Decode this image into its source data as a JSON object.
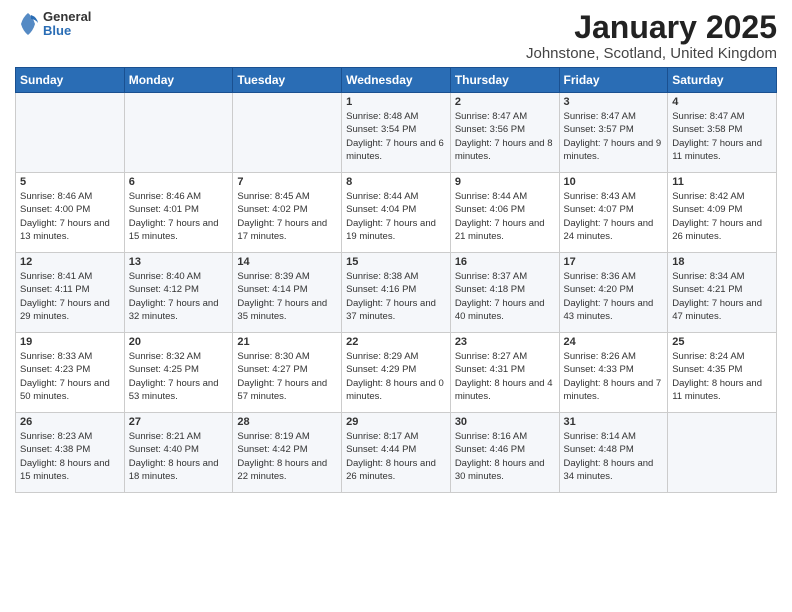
{
  "header": {
    "logo_general": "General",
    "logo_blue": "Blue",
    "main_title": "January 2025",
    "subtitle": "Johnstone, Scotland, United Kingdom"
  },
  "weekdays": [
    "Sunday",
    "Monday",
    "Tuesday",
    "Wednesday",
    "Thursday",
    "Friday",
    "Saturday"
  ],
  "weeks": [
    [
      {
        "day": "",
        "sunrise": "",
        "sunset": "",
        "daylight": ""
      },
      {
        "day": "",
        "sunrise": "",
        "sunset": "",
        "daylight": ""
      },
      {
        "day": "",
        "sunrise": "",
        "sunset": "",
        "daylight": ""
      },
      {
        "day": "1",
        "sunrise": "Sunrise: 8:48 AM",
        "sunset": "Sunset: 3:54 PM",
        "daylight": "Daylight: 7 hours and 6 minutes."
      },
      {
        "day": "2",
        "sunrise": "Sunrise: 8:47 AM",
        "sunset": "Sunset: 3:56 PM",
        "daylight": "Daylight: 7 hours and 8 minutes."
      },
      {
        "day": "3",
        "sunrise": "Sunrise: 8:47 AM",
        "sunset": "Sunset: 3:57 PM",
        "daylight": "Daylight: 7 hours and 9 minutes."
      },
      {
        "day": "4",
        "sunrise": "Sunrise: 8:47 AM",
        "sunset": "Sunset: 3:58 PM",
        "daylight": "Daylight: 7 hours and 11 minutes."
      }
    ],
    [
      {
        "day": "5",
        "sunrise": "Sunrise: 8:46 AM",
        "sunset": "Sunset: 4:00 PM",
        "daylight": "Daylight: 7 hours and 13 minutes."
      },
      {
        "day": "6",
        "sunrise": "Sunrise: 8:46 AM",
        "sunset": "Sunset: 4:01 PM",
        "daylight": "Daylight: 7 hours and 15 minutes."
      },
      {
        "day": "7",
        "sunrise": "Sunrise: 8:45 AM",
        "sunset": "Sunset: 4:02 PM",
        "daylight": "Daylight: 7 hours and 17 minutes."
      },
      {
        "day": "8",
        "sunrise": "Sunrise: 8:44 AM",
        "sunset": "Sunset: 4:04 PM",
        "daylight": "Daylight: 7 hours and 19 minutes."
      },
      {
        "day": "9",
        "sunrise": "Sunrise: 8:44 AM",
        "sunset": "Sunset: 4:06 PM",
        "daylight": "Daylight: 7 hours and 21 minutes."
      },
      {
        "day": "10",
        "sunrise": "Sunrise: 8:43 AM",
        "sunset": "Sunset: 4:07 PM",
        "daylight": "Daylight: 7 hours and 24 minutes."
      },
      {
        "day": "11",
        "sunrise": "Sunrise: 8:42 AM",
        "sunset": "Sunset: 4:09 PM",
        "daylight": "Daylight: 7 hours and 26 minutes."
      }
    ],
    [
      {
        "day": "12",
        "sunrise": "Sunrise: 8:41 AM",
        "sunset": "Sunset: 4:11 PM",
        "daylight": "Daylight: 7 hours and 29 minutes."
      },
      {
        "day": "13",
        "sunrise": "Sunrise: 8:40 AM",
        "sunset": "Sunset: 4:12 PM",
        "daylight": "Daylight: 7 hours and 32 minutes."
      },
      {
        "day": "14",
        "sunrise": "Sunrise: 8:39 AM",
        "sunset": "Sunset: 4:14 PM",
        "daylight": "Daylight: 7 hours and 35 minutes."
      },
      {
        "day": "15",
        "sunrise": "Sunrise: 8:38 AM",
        "sunset": "Sunset: 4:16 PM",
        "daylight": "Daylight: 7 hours and 37 minutes."
      },
      {
        "day": "16",
        "sunrise": "Sunrise: 8:37 AM",
        "sunset": "Sunset: 4:18 PM",
        "daylight": "Daylight: 7 hours and 40 minutes."
      },
      {
        "day": "17",
        "sunrise": "Sunrise: 8:36 AM",
        "sunset": "Sunset: 4:20 PM",
        "daylight": "Daylight: 7 hours and 43 minutes."
      },
      {
        "day": "18",
        "sunrise": "Sunrise: 8:34 AM",
        "sunset": "Sunset: 4:21 PM",
        "daylight": "Daylight: 7 hours and 47 minutes."
      }
    ],
    [
      {
        "day": "19",
        "sunrise": "Sunrise: 8:33 AM",
        "sunset": "Sunset: 4:23 PM",
        "daylight": "Daylight: 7 hours and 50 minutes."
      },
      {
        "day": "20",
        "sunrise": "Sunrise: 8:32 AM",
        "sunset": "Sunset: 4:25 PM",
        "daylight": "Daylight: 7 hours and 53 minutes."
      },
      {
        "day": "21",
        "sunrise": "Sunrise: 8:30 AM",
        "sunset": "Sunset: 4:27 PM",
        "daylight": "Daylight: 7 hours and 57 minutes."
      },
      {
        "day": "22",
        "sunrise": "Sunrise: 8:29 AM",
        "sunset": "Sunset: 4:29 PM",
        "daylight": "Daylight: 8 hours and 0 minutes."
      },
      {
        "day": "23",
        "sunrise": "Sunrise: 8:27 AM",
        "sunset": "Sunset: 4:31 PM",
        "daylight": "Daylight: 8 hours and 4 minutes."
      },
      {
        "day": "24",
        "sunrise": "Sunrise: 8:26 AM",
        "sunset": "Sunset: 4:33 PM",
        "daylight": "Daylight: 8 hours and 7 minutes."
      },
      {
        "day": "25",
        "sunrise": "Sunrise: 8:24 AM",
        "sunset": "Sunset: 4:35 PM",
        "daylight": "Daylight: 8 hours and 11 minutes."
      }
    ],
    [
      {
        "day": "26",
        "sunrise": "Sunrise: 8:23 AM",
        "sunset": "Sunset: 4:38 PM",
        "daylight": "Daylight: 8 hours and 15 minutes."
      },
      {
        "day": "27",
        "sunrise": "Sunrise: 8:21 AM",
        "sunset": "Sunset: 4:40 PM",
        "daylight": "Daylight: 8 hours and 18 minutes."
      },
      {
        "day": "28",
        "sunrise": "Sunrise: 8:19 AM",
        "sunset": "Sunset: 4:42 PM",
        "daylight": "Daylight: 8 hours and 22 minutes."
      },
      {
        "day": "29",
        "sunrise": "Sunrise: 8:17 AM",
        "sunset": "Sunset: 4:44 PM",
        "daylight": "Daylight: 8 hours and 26 minutes."
      },
      {
        "day": "30",
        "sunrise": "Sunrise: 8:16 AM",
        "sunset": "Sunset: 4:46 PM",
        "daylight": "Daylight: 8 hours and 30 minutes."
      },
      {
        "day": "31",
        "sunrise": "Sunrise: 8:14 AM",
        "sunset": "Sunset: 4:48 PM",
        "daylight": "Daylight: 8 hours and 34 minutes."
      },
      {
        "day": "",
        "sunrise": "",
        "sunset": "",
        "daylight": ""
      }
    ]
  ]
}
